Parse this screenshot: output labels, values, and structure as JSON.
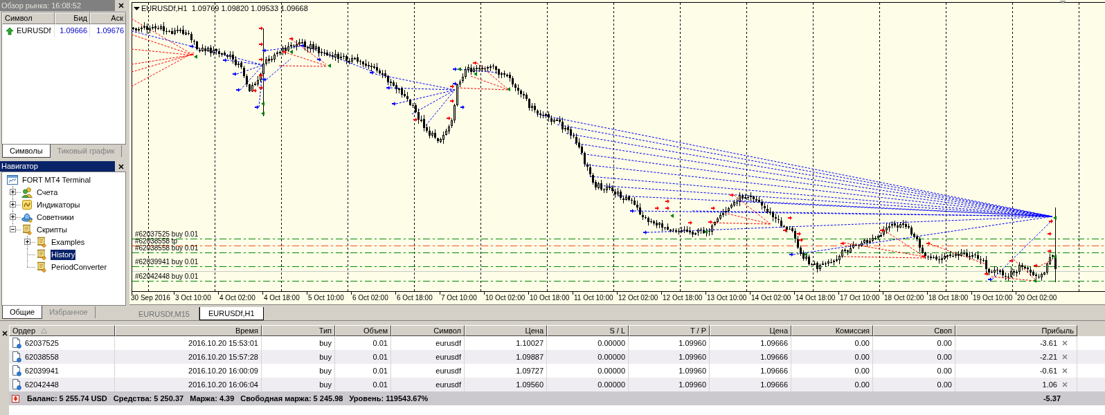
{
  "market_watch": {
    "title": "Обзор рынка: 16:08:52",
    "columns": [
      "Символ",
      "Бид",
      "Аск"
    ],
    "rows": [
      {
        "symbol": "EURUSDf",
        "bid": "1.09666",
        "ask": "1.09676",
        "rising": true
      }
    ],
    "tabs": [
      {
        "label": "Символы",
        "selected": true
      },
      {
        "label": "Тиковый график",
        "selected": false
      }
    ]
  },
  "navigator": {
    "title": "Навигатор",
    "tree": [
      {
        "label": "FORT MT4 Terminal",
        "kind": "terminal",
        "selected": false,
        "children": [
          {
            "label": "Счета",
            "kind": "accounts",
            "expanded": false,
            "selected": false
          },
          {
            "label": "Индикаторы",
            "kind": "indicators",
            "expanded": false,
            "selected": false
          },
          {
            "label": "Советники",
            "kind": "experts",
            "expanded": false,
            "selected": false
          },
          {
            "label": "Скрипты",
            "kind": "script",
            "expanded": true,
            "selected": false,
            "children": [
              {
                "label": "Examples",
                "kind": "script",
                "expanded": false,
                "selected": false
              },
              {
                "label": "History",
                "kind": "script",
                "selected": true
              },
              {
                "label": "PeriodConverter",
                "kind": "script",
                "selected": false
              }
            ]
          }
        ]
      }
    ],
    "tabs": [
      {
        "label": "Общие",
        "selected": true
      },
      {
        "label": "Избранное",
        "selected": false
      }
    ]
  },
  "chart": {
    "symbol": "EURUSDf,H1",
    "prices": "1.09769 1.09820 1.09533 1.09668",
    "order_lines": [
      {
        "label": "#62037525 buy 0.01",
        "kind": "open"
      },
      {
        "label": "#62038558 tp",
        "kind": "take_profit"
      },
      {
        "label": "#62038558 buy 0.01",
        "kind": "open"
      },
      {
        "label": "#62039941 buy 0.01",
        "kind": "open"
      },
      {
        "label": "#62042448 buy 0.01",
        "kind": "open"
      }
    ],
    "time_labels": [
      "30 Sep 2016",
      "3 Oct 10:00",
      "4 Oct 02:00",
      "4 Oct 18:00",
      "5 Oct 10:00",
      "6 Oct 02:00",
      "6 Oct 18:00",
      "7 Oct 10:00",
      "10 Oct 02:00",
      "10 Oct 18:00",
      "11 Oct 10:00",
      "12 Oct 02:00",
      "12 Oct 18:00",
      "13 Oct 10:00",
      "14 Oct 02:00",
      "14 Oct 18:00",
      "17 Oct 10:00",
      "18 Oct 02:00",
      "18 Oct 18:00",
      "19 Oct 10:00",
      "20 Oct 02:00"
    ],
    "tabs": [
      {
        "label": "EURUSDf,M15",
        "selected": false
      },
      {
        "label": "EURUSDf,H1",
        "selected": true
      }
    ]
  },
  "terminal": {
    "columns": [
      {
        "label": "Ордер",
        "sorted": true
      },
      {
        "label": "Время",
        "sorted": false
      },
      {
        "label": "Тип",
        "sorted": false
      },
      {
        "label": "Объем",
        "sorted": false
      },
      {
        "label": "Символ",
        "sorted": false
      },
      {
        "label": "Цена",
        "sorted": false
      },
      {
        "label": "S / L",
        "sorted": false
      },
      {
        "label": "T / P",
        "sorted": false
      },
      {
        "label": "Цена",
        "sorted": false
      },
      {
        "label": "Комиссия",
        "sorted": false
      },
      {
        "label": "Своп",
        "sorted": false
      },
      {
        "label": "Прибыль",
        "sorted": false
      }
    ],
    "rows": [
      {
        "order": "62037525",
        "time": "2016.10.20 15:53:01",
        "type": "buy",
        "volume": "0.01",
        "symbol": "eurusdf",
        "price": "1.10027",
        "sl": "0.00000",
        "tp": "1.09960",
        "current_price": "1.09666",
        "commission": "0.00",
        "swap": "0.00",
        "profit": "-3.61"
      },
      {
        "order": "62038558",
        "time": "2016.10.20 15:57:28",
        "type": "buy",
        "volume": "0.01",
        "symbol": "eurusdf",
        "price": "1.09887",
        "sl": "0.00000",
        "tp": "1.09960",
        "current_price": "1.09666",
        "commission": "0.00",
        "swap": "0.00",
        "profit": "-2.21"
      },
      {
        "order": "62039941",
        "time": "2016.10.20 16:00:09",
        "type": "buy",
        "volume": "0.01",
        "symbol": "eurusdf",
        "price": "1.09727",
        "sl": "0.00000",
        "tp": "1.09960",
        "current_price": "1.09666",
        "commission": "0.00",
        "swap": "0.00",
        "profit": "-0.61"
      },
      {
        "order": "62042448",
        "time": "2016.10.20 16:06:04",
        "type": "buy",
        "volume": "0.01",
        "symbol": "eurusdf",
        "price": "1.09560",
        "sl": "0.00000",
        "tp": "1.09960",
        "current_price": "1.09666",
        "commission": "0.00",
        "swap": "0.00",
        "profit": "1.06"
      }
    ],
    "summary": {
      "items": [
        "Баланс: 5 255.74 USD",
        "Средства: 5 250.37",
        "Маржа: 4.39",
        "Свободная маржа: 5 245.98",
        "Уровень: 119543.67%"
      ],
      "profit": "-5.37"
    }
  }
}
